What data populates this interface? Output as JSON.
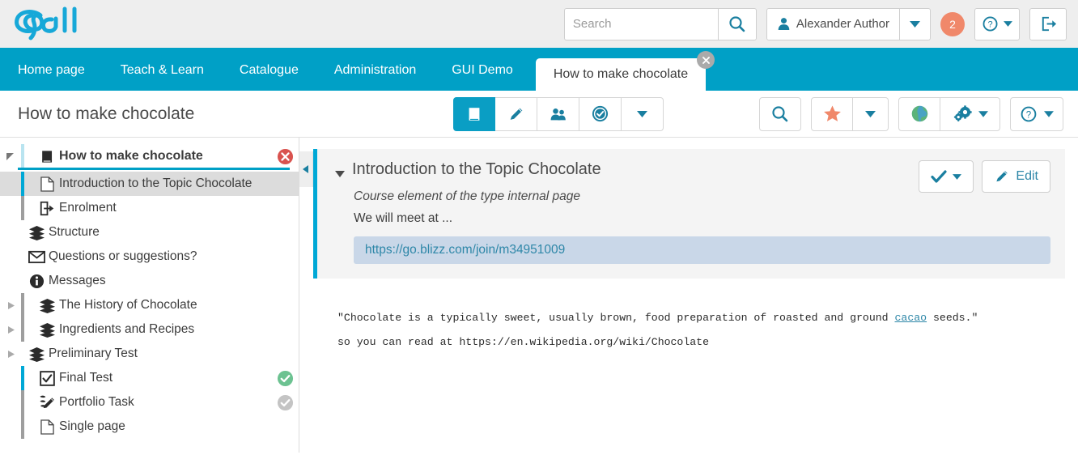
{
  "colors": {
    "brand_teal": "#00a0c6",
    "active_teal": "#0a9ec4",
    "badge_orange": "#f0886a",
    "link_teal": "#2e87a8",
    "status_green": "#6cc291",
    "status_gray": "#c4c4c4",
    "close_red": "#d9534f",
    "linkbox_bg": "#c9d7e8"
  },
  "header": {
    "logo_name": "opal-logo",
    "search": {
      "placeholder": "Search",
      "value": "",
      "icon": "search-icon"
    },
    "user": {
      "name": "Alexander Author",
      "icon": "person-icon",
      "caret": "chevron-down-icon"
    },
    "notifications": {
      "count": "2"
    },
    "help": {
      "icon": "question-circle-icon",
      "caret": "chevron-down-icon"
    },
    "logout": {
      "icon": "logout-icon"
    }
  },
  "nav": {
    "items": [
      {
        "label": "Home page",
        "active": false
      },
      {
        "label": "Teach & Learn",
        "active": false
      },
      {
        "label": "Catalogue",
        "active": false
      },
      {
        "label": "Administration",
        "active": false
      },
      {
        "label": "GUI Demo",
        "active": false
      }
    ],
    "active_tab": {
      "label": "How to make chocolate",
      "close_icon": "close-icon"
    }
  },
  "toolbar": {
    "page_title": "How to make chocolate",
    "segments": [
      {
        "icon": "book-icon",
        "active": true
      },
      {
        "icon": "pencil-icon",
        "active": false
      },
      {
        "icon": "members-icon",
        "active": false
      },
      {
        "icon": "certificate-icon",
        "active": false
      },
      {
        "icon": "chevron-down-icon",
        "active": false
      }
    ],
    "right_buttons": [
      {
        "icon": "search-icon",
        "name": "course-search-button"
      },
      {
        "icon": "star-icon",
        "name": "bookmark-button"
      },
      {
        "icon": "chevron-down-icon",
        "name": "bookmark-dropdown"
      },
      {
        "icon": "globe-icon",
        "name": "publish-button"
      },
      {
        "icon": "gears-icon",
        "name": "settings-button"
      },
      {
        "icon": "chevron-down-icon",
        "name": "settings-dropdown"
      },
      {
        "icon": "question-circle-icon",
        "name": "help-button"
      },
      {
        "icon": "chevron-down-icon",
        "name": "help-dropdown"
      }
    ]
  },
  "sidebar": {
    "collapse_icon": "collapse-left-icon",
    "items": [
      {
        "label": "How to make chocolate",
        "icon": "book-icon",
        "level": 0,
        "root": true,
        "arrow": "expanded",
        "status": "remove-icon",
        "selected": false
      },
      {
        "label": "Introduction to the Topic Chocolate",
        "icon": "page-icon",
        "level": 1,
        "arrow": "none",
        "status": "none",
        "selected": true,
        "bar": "teal"
      },
      {
        "label": "Enrolment",
        "icon": "enrol-icon",
        "level": 1,
        "arrow": "none",
        "status": "none",
        "selected": false,
        "bar": "gray"
      },
      {
        "label": "Structure",
        "icon": "layers-icon",
        "level": 0,
        "arrow": "none",
        "status": "none",
        "selected": false
      },
      {
        "label": "Questions or suggestions?",
        "icon": "envelope-icon",
        "level": 0,
        "arrow": "none",
        "status": "none",
        "selected": false
      },
      {
        "label": "Messages",
        "icon": "info-icon",
        "level": 0,
        "arrow": "none",
        "status": "none",
        "selected": false
      },
      {
        "label": "The History of Chocolate",
        "icon": "layers-icon",
        "level": 1,
        "arrow": "collapsed",
        "status": "none",
        "selected": false,
        "bar": "gray"
      },
      {
        "label": "Ingredients and Recipes",
        "icon": "layers-icon",
        "level": 1,
        "arrow": "collapsed",
        "status": "none",
        "selected": false,
        "bar": "gray"
      },
      {
        "label": "Preliminary Test",
        "icon": "layers-icon",
        "level": 0,
        "arrow": "collapsed",
        "status": "none",
        "selected": false
      },
      {
        "label": "Final Test",
        "icon": "checkbox-icon",
        "level": 1,
        "arrow": "none",
        "status": "check-green-icon",
        "selected": false,
        "bar": "teal"
      },
      {
        "label": "Portfolio Task",
        "icon": "portfolio-icon",
        "level": 1,
        "arrow": "none",
        "status": "check-gray-icon",
        "selected": false,
        "bar": "gray"
      },
      {
        "label": "Single page",
        "icon": "page-icon",
        "level": 1,
        "arrow": "none",
        "status": "none",
        "selected": false,
        "bar": "gray"
      }
    ]
  },
  "content": {
    "course_element": {
      "caret": "caret-down-icon",
      "title": "Introduction to the Topic Chocolate",
      "subtitle": "Course element of the type internal page",
      "text": "We will meet at ...",
      "link": "https://go.blizz.com/join/m34951009"
    },
    "actions": {
      "status_icon": "check-icon",
      "status_caret": "chevron-down-icon",
      "edit_icon": "pencil-icon",
      "edit_label": "Edit"
    },
    "body": {
      "line1_pre": "\"Chocolate is a typically sweet, usually brown, food preparation of roasted and ground ",
      "line1_link": "cacao",
      "line1_post": " seeds.\"",
      "line2": "so you can read at https://en.wikipedia.org/wiki/Chocolate"
    }
  }
}
